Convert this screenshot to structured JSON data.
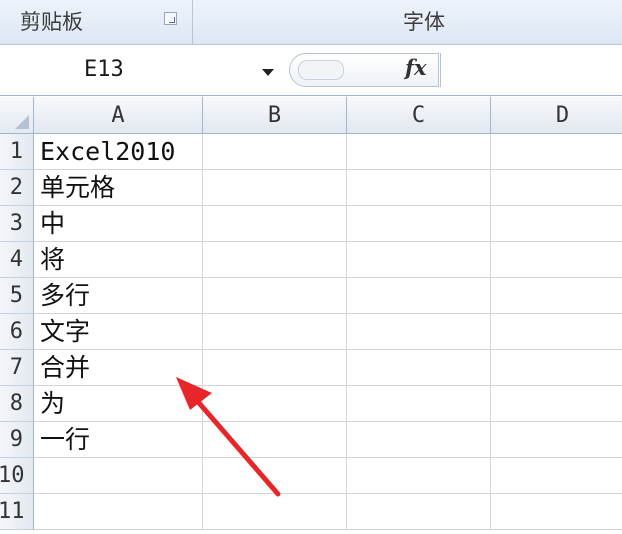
{
  "ribbon": {
    "clipboard_label": "剪贴板",
    "font_label": "字体"
  },
  "formula_bar": {
    "name_box": "E13",
    "fx_label": "fx",
    "formula": ""
  },
  "columns": [
    "A",
    "B",
    "C",
    "D"
  ],
  "rows": [
    {
      "num": "1",
      "a": "Excel2010"
    },
    {
      "num": "2",
      "a": "单元格"
    },
    {
      "num": "3",
      "a": "中"
    },
    {
      "num": "4",
      "a": "将"
    },
    {
      "num": "5",
      "a": "多行"
    },
    {
      "num": "6",
      "a": "文字"
    },
    {
      "num": "7",
      "a": "合并"
    },
    {
      "num": "8",
      "a": "为"
    },
    {
      "num": "9",
      "a": "一行"
    },
    {
      "num": "10",
      "a": ""
    },
    {
      "num": "11",
      "a": ""
    }
  ],
  "colors": {
    "arrow": "#e8262a"
  }
}
